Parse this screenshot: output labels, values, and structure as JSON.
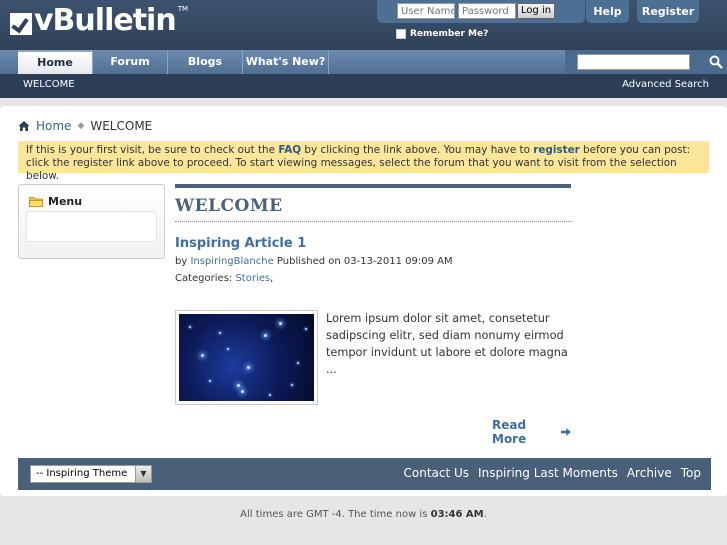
{
  "header": {
    "logo_text": "vBulletin",
    "logo_tm": "TM",
    "login": {
      "username_placeholder": "User Name",
      "password_placeholder": "Password",
      "login_label": "Log in",
      "remember_label": "Remember Me?"
    },
    "help_label": "Help",
    "register_label": "Register"
  },
  "nav": {
    "tabs": [
      {
        "label": "Home",
        "active": true
      },
      {
        "label": "Forum"
      },
      {
        "label": "Blogs"
      },
      {
        "label": "What's New?"
      }
    ],
    "search_placeholder": ""
  },
  "subnav": {
    "welcome_label": "WELCOME",
    "advanced_search_label": "Advanced Search"
  },
  "breadcrumb": {
    "home_label": "Home",
    "current_label": "WELCOME"
  },
  "notice": {
    "part1": "If this is your first visit, be sure to check out the ",
    "faq": "FAQ",
    "part2": " by clicking the link above. You may have to ",
    "register": "register",
    "part3": " before you can post: click the register link above to proceed. To start viewing messages, select the forum that you want to visit from the selection below."
  },
  "menu": {
    "title": "Menu"
  },
  "article": {
    "heading": "WELCOME",
    "title": "Inspiring Article 1",
    "meta_by": "by ",
    "author": "InspiringBlanche",
    "meta_published": " Published on 03-13-2011 09:09 AM",
    "categories_label": "Categories: ",
    "category": "Stories",
    "category_sep": ",",
    "excerpt": "Lorem ipsum dolor sit amet, consetetur sadipscing elitr, sed diam nonumy eirmod tempor invidunt ut labore et dolore magna ...",
    "read_more": "Read More"
  },
  "footer": {
    "theme_selected": "-- Inspiring Theme",
    "links": [
      "Contact Us",
      "Inspiring Last Moments",
      "Archive",
      "Top"
    ],
    "time_prefix": "All times are GMT -4. The time now is ",
    "time_value": "03:46 AM",
    "time_suffix": "."
  },
  "colors": {
    "header_dark": "#2f4158",
    "nav_blue": "#4f6f93",
    "link_blue": "#3f6fa0",
    "notice_yellow": "#fbe69a",
    "footer_bar": "#4a5f78"
  }
}
